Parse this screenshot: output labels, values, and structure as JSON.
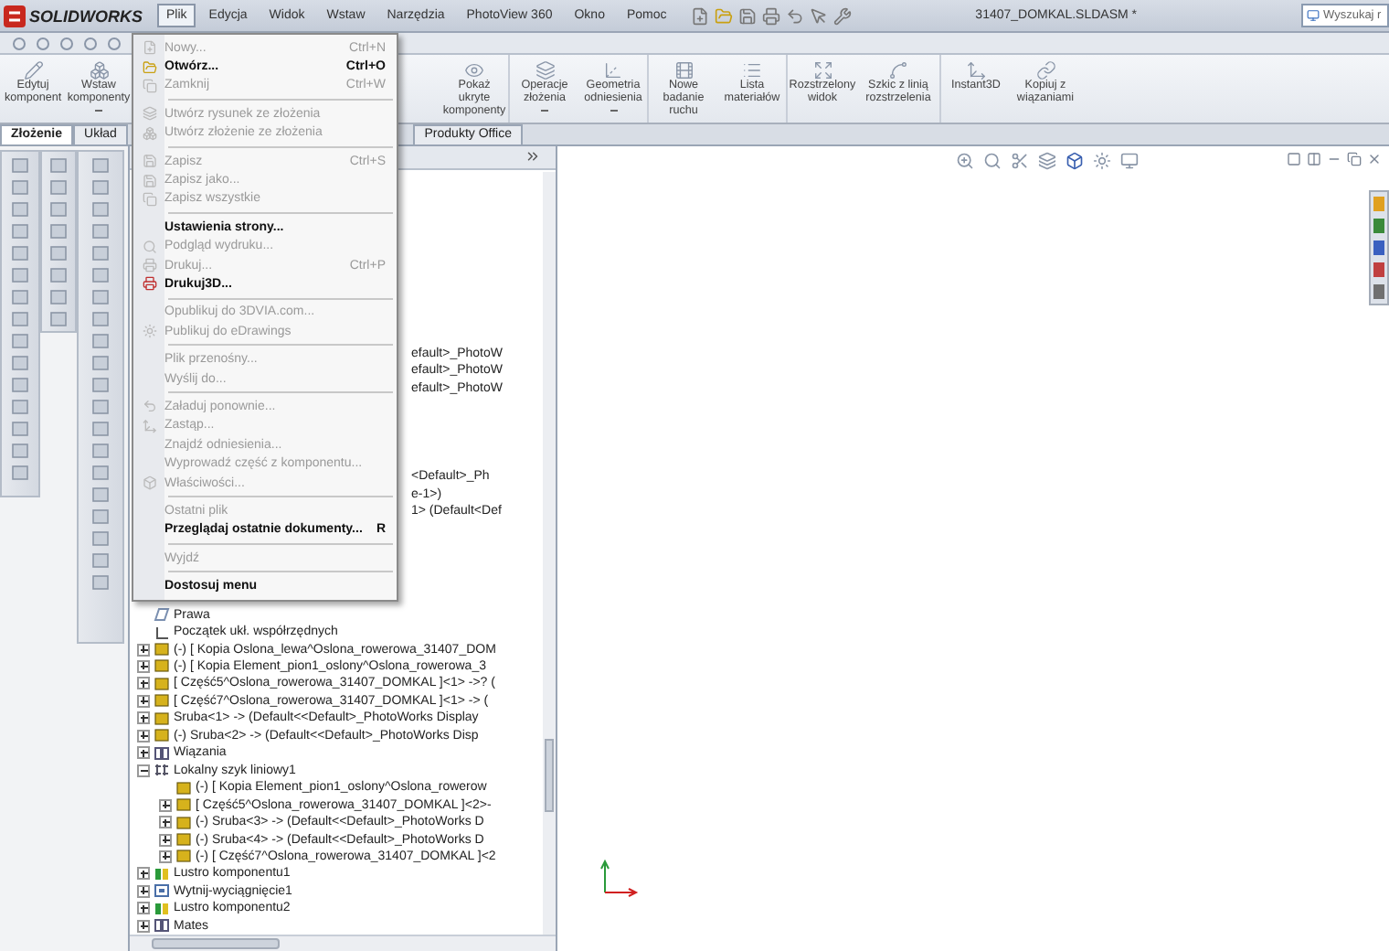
{
  "app": {
    "logo": "SOLIDWORKS",
    "title": "31407_DOMKAL.SLDASM *",
    "search": {
      "placeholder": "Wyszukaj r"
    }
  },
  "menubar": [
    {
      "label": "Plik",
      "selected": true
    },
    {
      "label": "Edycja",
      "selected": false
    },
    {
      "label": "Widok",
      "selected": false
    },
    {
      "label": "Wstaw",
      "selected": false
    },
    {
      "label": "Narzędzia",
      "selected": false
    },
    {
      "label": "PhotoView 360",
      "selected": false
    },
    {
      "label": "Okno",
      "selected": false
    },
    {
      "label": "Pomoc",
      "selected": false
    }
  ],
  "commands_left": [
    {
      "label": "Edytuj komponent",
      "dropdown": false
    },
    {
      "label": "Wstaw komponenty",
      "dropdown": true
    }
  ],
  "commands_right": [
    {
      "label": "Pokaż ukryte komponenty",
      "dropdown": false
    },
    {
      "label": "Operacje złożenia",
      "dropdown": true
    },
    {
      "label": "Geometria odniesienia",
      "dropdown": true
    },
    {
      "label": "Nowe badanie ruchu",
      "dropdown": false
    },
    {
      "label": "Lista materiałów",
      "dropdown": false
    },
    {
      "label": "Rozstrzelony widok",
      "dropdown": false
    },
    {
      "label": "Szkic z linią rozstrzelenia",
      "dropdown": false
    },
    {
      "label": "Instant3D",
      "dropdown": false
    },
    {
      "label": "Kopiuj z wiązaniami",
      "dropdown": false
    }
  ],
  "tabs_left": [
    {
      "label": "Złożenie",
      "selected": true
    },
    {
      "label": "Układ",
      "selected": false
    }
  ],
  "tabs_right": [
    {
      "label": "Produkty Office",
      "selected": false
    }
  ],
  "file_menu": [
    {
      "kind": "item",
      "label": "Nowy...",
      "shortcut": "Ctrl+N",
      "disabled": true
    },
    {
      "kind": "item",
      "label": "Otwórz...",
      "shortcut": "Ctrl+O",
      "disabled": false
    },
    {
      "kind": "item",
      "label": "Zamknij",
      "shortcut": "Ctrl+W",
      "disabled": true
    },
    {
      "kind": "separator"
    },
    {
      "kind": "item",
      "label": "Utwórz rysunek ze złożenia",
      "disabled": true
    },
    {
      "kind": "item",
      "label": "Utwórz złożenie ze złożenia",
      "disabled": true
    },
    {
      "kind": "separator"
    },
    {
      "kind": "item",
      "label": "Zapisz",
      "shortcut": "Ctrl+S",
      "disabled": true
    },
    {
      "kind": "item",
      "label": "Zapisz jako...",
      "disabled": true
    },
    {
      "kind": "item",
      "label": "Zapisz wszystkie",
      "disabled": true
    },
    {
      "kind": "separator"
    },
    {
      "kind": "item",
      "label": "Ustawienia strony...",
      "disabled": false
    },
    {
      "kind": "item",
      "label": "Podgląd wydruku...",
      "disabled": true
    },
    {
      "kind": "item",
      "label": "Drukuj...",
      "shortcut": "Ctrl+P",
      "disabled": true
    },
    {
      "kind": "item",
      "label": "Drukuj3D...",
      "disabled": false
    },
    {
      "kind": "separator"
    },
    {
      "kind": "item",
      "label": "Opublikuj do 3DVIA.com...",
      "disabled": true
    },
    {
      "kind": "item",
      "label": "Publikuj do eDrawings",
      "disabled": true
    },
    {
      "kind": "separator"
    },
    {
      "kind": "item",
      "label": "Plik przenośny...",
      "disabled": true
    },
    {
      "kind": "item",
      "label": "Wyślij do...",
      "disabled": true
    },
    {
      "kind": "separator"
    },
    {
      "kind": "item",
      "label": "Załaduj ponownie...",
      "disabled": true
    },
    {
      "kind": "item",
      "label": "Zastąp...",
      "disabled": true
    },
    {
      "kind": "item",
      "label": "Znajdź odniesienia...",
      "disabled": true
    },
    {
      "kind": "item",
      "label": "Wyprowadź część z komponentu...",
      "disabled": true
    },
    {
      "kind": "item",
      "label": "Właściwości...",
      "disabled": true
    },
    {
      "kind": "separator"
    },
    {
      "kind": "item",
      "label": "Ostatni plik",
      "disabled": true
    },
    {
      "kind": "item",
      "label": "Przeglądaj ostatnie dokumenty...",
      "shortcut": "R",
      "disabled": false
    },
    {
      "kind": "separator"
    },
    {
      "kind": "item",
      "label": "Wyjdź",
      "disabled": true
    },
    {
      "kind": "separator"
    },
    {
      "kind": "item",
      "label": "Dostosuj menu",
      "disabled": false
    }
  ],
  "tree_covered": [
    {
      "text": "efault>_PhotoW"
    },
    {
      "text": "efault>_PhotoW"
    },
    {
      "text": "efault>_PhotoW"
    },
    {
      "text": "<Default>_Ph"
    },
    {
      "text": "e-1>)"
    },
    {
      "text": "1> (Default<Def"
    }
  ],
  "tree": [
    {
      "kind": "plane",
      "label": "Prawa"
    },
    {
      "kind": "origin",
      "label": "Początek ukł. współrzędnych"
    },
    {
      "kind": "part",
      "label": "(-) [ Kopia Oslona_lewa^Oslona_rowerowa_31407_DOM",
      "expanded": false
    },
    {
      "kind": "part",
      "label": "(-) [ Kopia Element_pion1_oslony^Oslona_rowerowa_3",
      "expanded": false
    },
    {
      "kind": "part",
      "label": "[ Część5^Oslona_rowerowa_31407_DOMKAL ]<1> ->? (",
      "expanded": false
    },
    {
      "kind": "part",
      "label": "[ Część7^Oslona_rowerowa_31407_DOMKAL ]<1> -> (",
      "expanded": false
    },
    {
      "kind": "part",
      "label": "Sruba<1> -> (Default<<Default>_PhotoWorks Display",
      "expanded": false
    },
    {
      "kind": "part",
      "label": "(-) Sruba<2> -> (Default<<Default>_PhotoWorks Disp",
      "expanded": false
    },
    {
      "kind": "mates",
      "label": "Wiązania",
      "expanded": false
    },
    {
      "kind": "pattern",
      "label": "Lokalny szyk liniowy1",
      "expanded": true,
      "children": [
        {
          "kind": "part",
          "label": "(-) [ Kopia Element_pion1_oslony^Oslona_rowerow"
        },
        {
          "kind": "part",
          "label": "[ Część5^Oslona_rowerowa_31407_DOMKAL ]<2>-",
          "expanded": false
        },
        {
          "kind": "part",
          "label": "(-) Sruba<3> -> (Default<<Default>_PhotoWorks D",
          "expanded": false
        },
        {
          "kind": "part",
          "label": "(-) Sruba<4> -> (Default<<Default>_PhotoWorks D",
          "expanded": false
        },
        {
          "kind": "part",
          "label": "(-) [ Część7^Oslona_rowerowa_31407_DOMKAL ]<2",
          "expanded": false
        }
      ]
    },
    {
      "kind": "mirror",
      "label": "Lustro komponentu1",
      "expanded": false
    },
    {
      "kind": "cut",
      "label": "Wytnij-wyciągnięcie1",
      "expanded": false
    },
    {
      "kind": "mirror",
      "label": "Lustro komponentu2",
      "expanded": false
    },
    {
      "kind": "mates",
      "label": "Mates",
      "expanded": false
    }
  ]
}
